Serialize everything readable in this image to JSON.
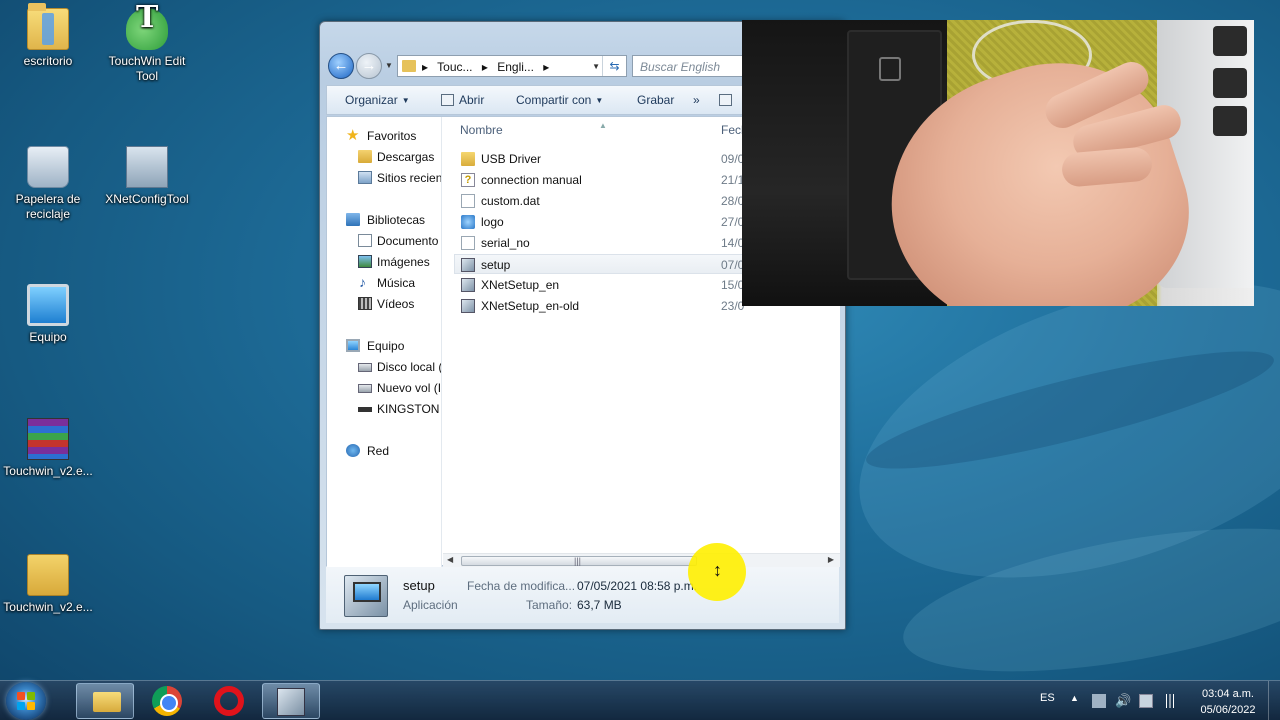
{
  "desktop": {
    "icons": [
      {
        "label": "escritorio",
        "icon": "folder-icon"
      },
      {
        "label": "TouchWin Edit Tool",
        "icon": "touchwin-icon"
      },
      {
        "label": "Papelera de reciclaje",
        "icon": "recycle-bin-icon"
      },
      {
        "label": "XNetConfigTool",
        "icon": "xnetconfig-icon"
      },
      {
        "label": "Equipo",
        "icon": "computer-icon"
      },
      {
        "label": "Touchwin_v2.e...",
        "icon": "winrar-archive-icon"
      },
      {
        "label": "Touchwin_v2.e...",
        "icon": "zip-folder-icon"
      }
    ]
  },
  "explorer": {
    "breadcrumb": [
      "Touc...",
      "Engli..."
    ],
    "search_placeholder": "Buscar English",
    "toolbar": {
      "organize": "Organizar",
      "open": "Abrir",
      "share": "Compartir con",
      "burn": "Grabar",
      "more": "»"
    },
    "nav": {
      "favorites": "Favoritos",
      "downloads": "Descargas",
      "recent_places": "Sitios recien",
      "libraries": "Bibliotecas",
      "documents": "Documento",
      "pictures": "Imágenes",
      "music": "Música",
      "videos": "Vídeos",
      "computer": "Equipo",
      "local_disk": "Disco local (",
      "new_volume": "Nuevo vol (I",
      "kingston": "KINGSTON (",
      "network": "Red"
    },
    "columns": {
      "name": "Nombre",
      "date": "Fech"
    },
    "files": [
      {
        "name": "USB Driver",
        "date": "09/0",
        "icon": "folder-icon"
      },
      {
        "name": "connection manual",
        "date": "21/1",
        "icon": "help-file-icon"
      },
      {
        "name": "custom.dat",
        "date": "28/0",
        "icon": "blank-file-icon"
      },
      {
        "name": "logo",
        "date": "27/0",
        "icon": "image-file-icon"
      },
      {
        "name": "serial_no",
        "date": "14/0",
        "icon": "blank-file-icon"
      },
      {
        "name": "setup",
        "date": "07/0",
        "icon": "setup-exe-icon",
        "selected": true
      },
      {
        "name": "XNetSetup_en",
        "date": "15/0",
        "icon": "setup-exe-icon"
      },
      {
        "name": "XNetSetup_en-old",
        "date": "23/0",
        "icon": "setup-exe-icon"
      }
    ],
    "details": {
      "name": "setup",
      "type": "Aplicación",
      "modified_label": "Fecha de modifica...",
      "modified_value": "07/05/2021 08:58 p.m.",
      "size_label": "Tamaño:",
      "size_value": "63,7 MB"
    }
  },
  "taskbar": {
    "language": "ES",
    "time": "03:04 a.m.",
    "date": "05/06/2022",
    "pinned": [
      "windows-explorer-icon",
      "chrome-icon",
      "opera-icon",
      "setup-app-icon"
    ]
  },
  "colors": {
    "cursor_highlight": "#ffef00",
    "desktop_bg": "#1f6f9c"
  }
}
